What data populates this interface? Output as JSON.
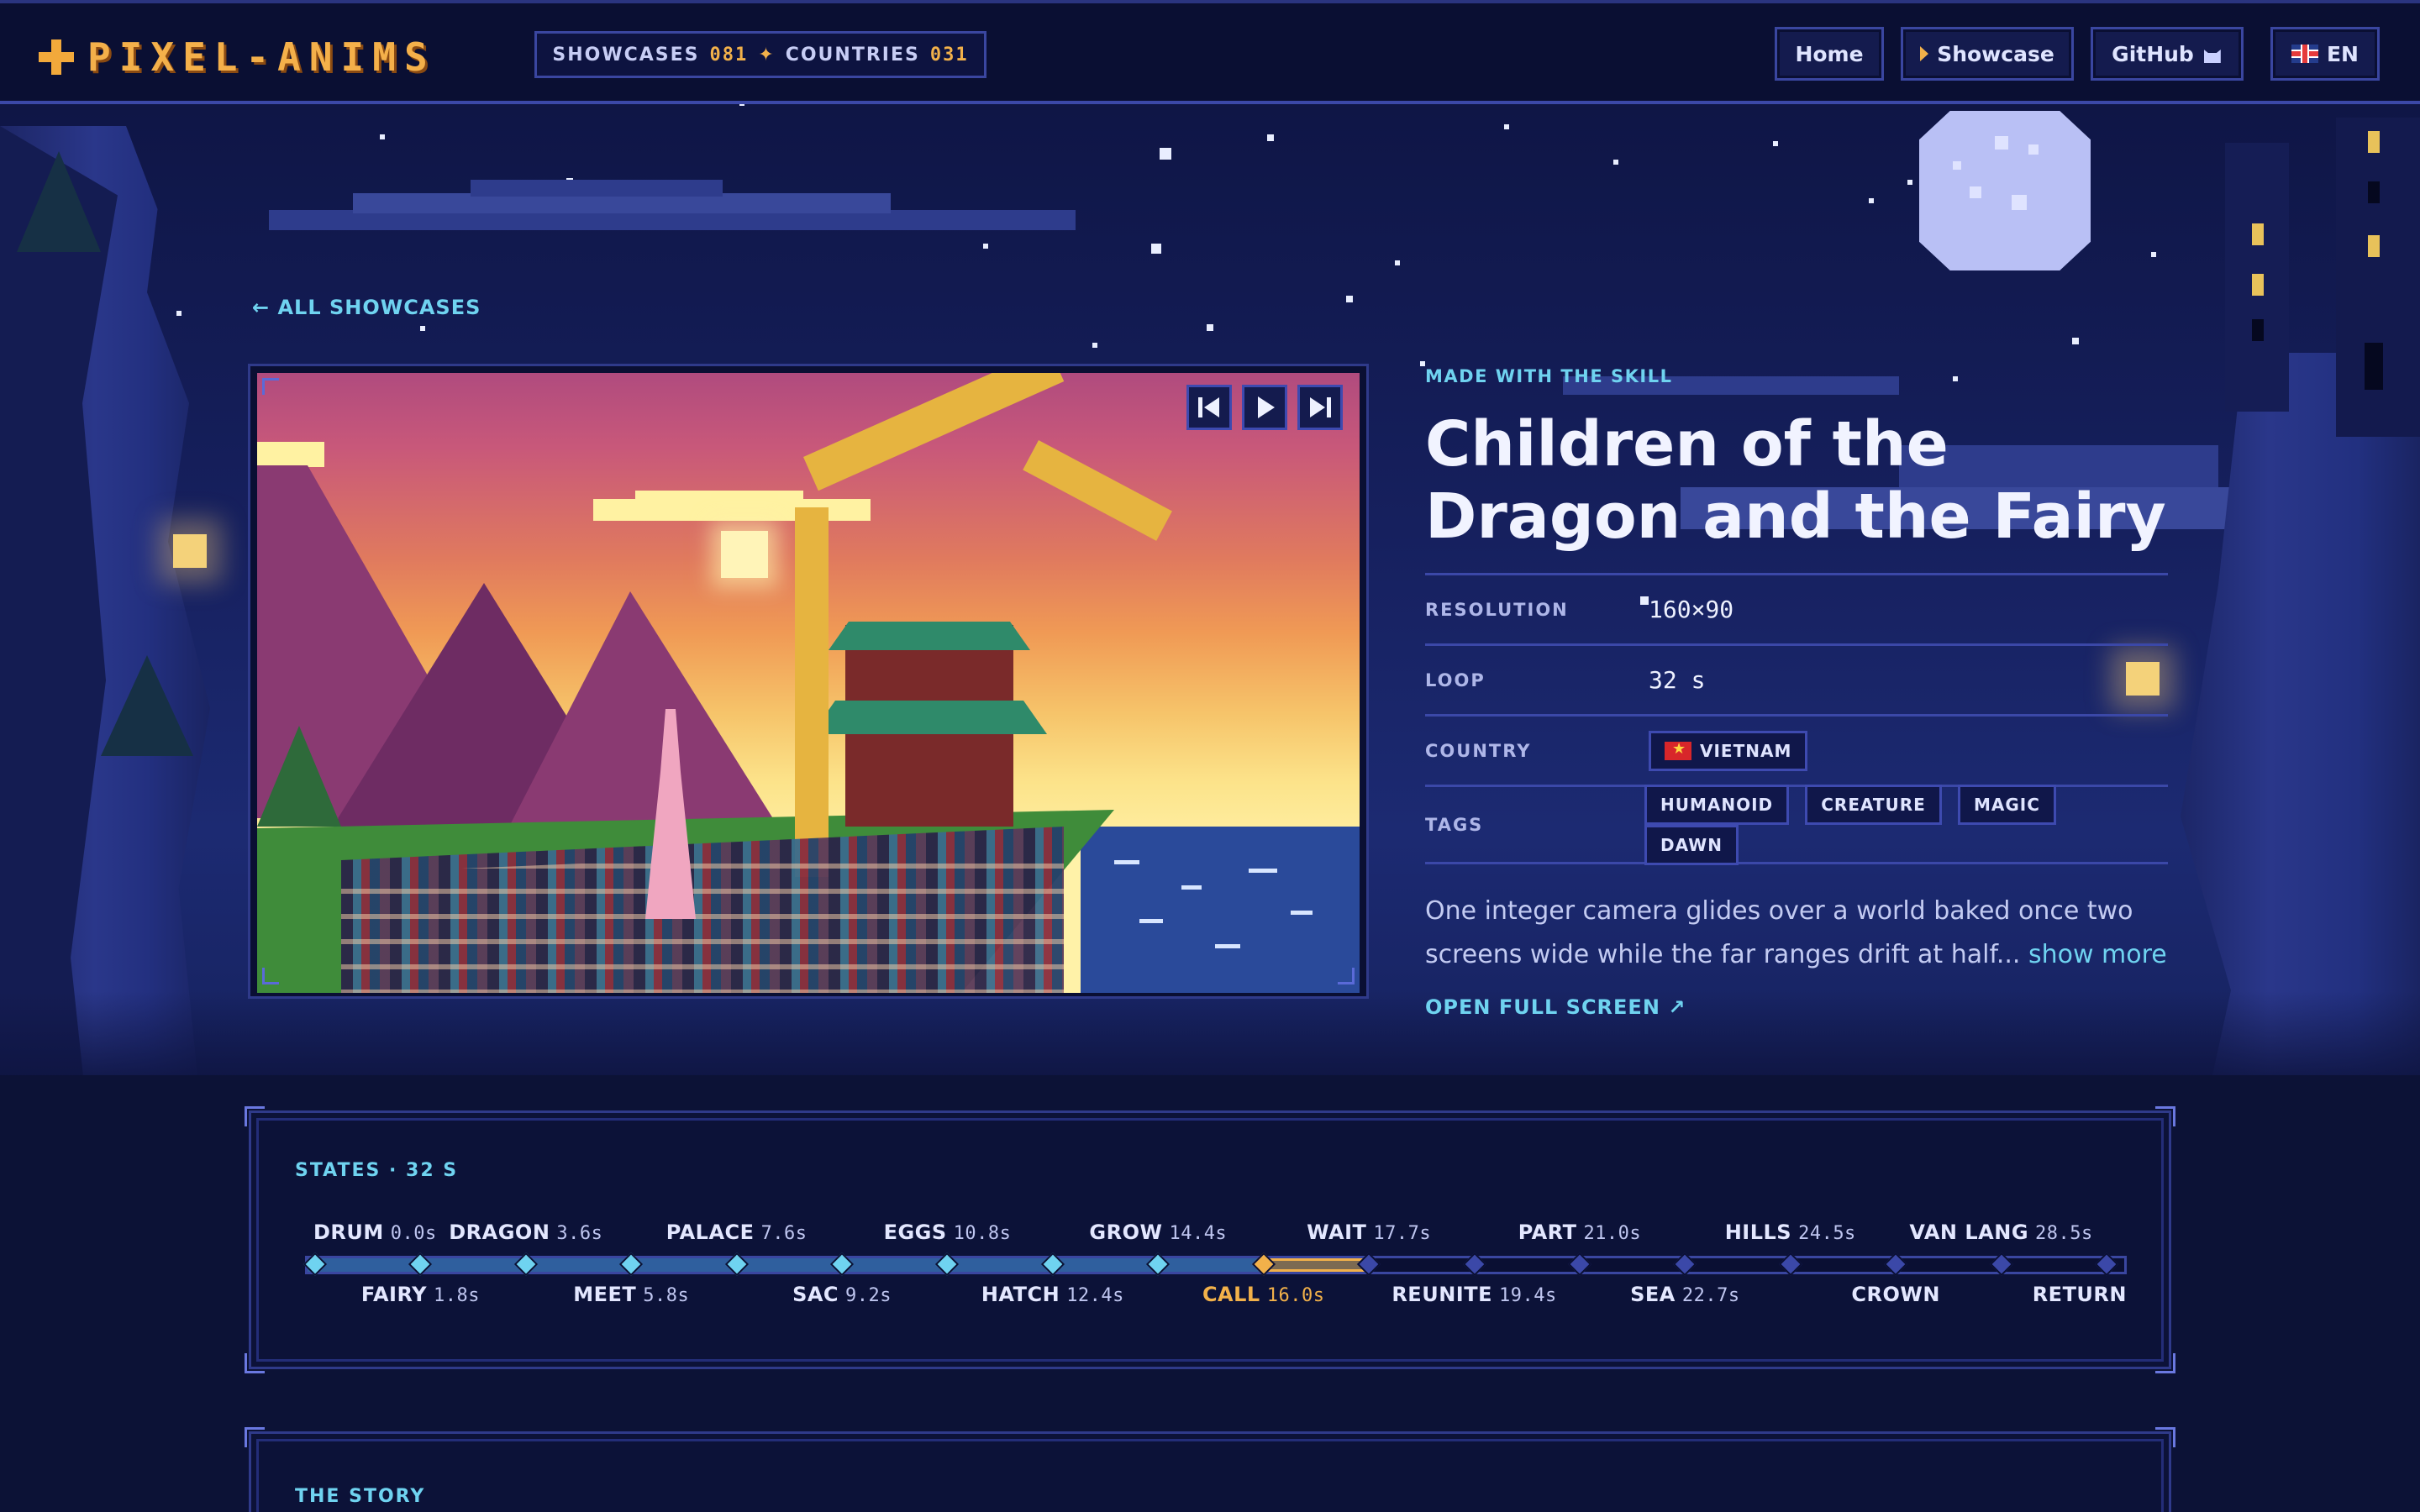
{
  "header": {
    "logo_text": "PIXEL-ANIMS",
    "showcases_label": "SHOWCASES",
    "showcases_count": "081",
    "countries_label": "COUNTRIES",
    "countries_count": "031",
    "nav": {
      "home": "Home",
      "showcase": "Showcase",
      "github": "GitHub",
      "language": "EN"
    }
  },
  "back_link": "← ALL SHOWCASES",
  "info": {
    "made_with": "MADE WITH THE SKILL",
    "title": "Children of the Dragon and the Fairy",
    "meta": [
      {
        "key": "RESOLUTION",
        "value": "160×90"
      },
      {
        "key": "LOOP",
        "value": "32 s"
      },
      {
        "key": "COUNTRY",
        "value": "VIETNAM"
      },
      {
        "key": "TAGS",
        "value": ""
      }
    ],
    "tags": [
      "HUMANOID",
      "CREATURE",
      "MAGIC",
      "DAWN"
    ],
    "description": "One integer camera glides over a world baked once two screens wide while the far ranges drift at half... ",
    "show_more": "show more",
    "open_full_screen": "OPEN FULL SCREEN ↗"
  },
  "states": {
    "title": "STATES · 32 S",
    "total_seconds": 32,
    "current_index": 9,
    "items": [
      {
        "name": "DRUM",
        "time": "0.0s"
      },
      {
        "name": "FAIRY",
        "time": "1.8s"
      },
      {
        "name": "DRAGON",
        "time": "3.6s"
      },
      {
        "name": "MEET",
        "time": "5.8s"
      },
      {
        "name": "PALACE",
        "time": "7.6s"
      },
      {
        "name": "SAC",
        "time": "9.2s"
      },
      {
        "name": "EGGS",
        "time": "10.8s"
      },
      {
        "name": "HATCH",
        "time": "12.4s"
      },
      {
        "name": "GROW",
        "time": "14.4s"
      },
      {
        "name": "CALL",
        "time": "16.0s"
      },
      {
        "name": "WAIT",
        "time": "17.7s"
      },
      {
        "name": "REUNITE",
        "time": "19.4s"
      },
      {
        "name": "PART",
        "time": "21.0s"
      },
      {
        "name": "SEA",
        "time": "22.7s"
      },
      {
        "name": "HILLS",
        "time": "24.5s"
      },
      {
        "name": "CROWN",
        "time": ""
      },
      {
        "name": "VAN LANG",
        "time": "28.5s"
      },
      {
        "name": "RETURN",
        "time": ""
      }
    ]
  },
  "story": {
    "title": "THE STORY"
  },
  "colors": {
    "accent_cyan": "#6fd3f0",
    "accent_gold": "#f2b14a",
    "panel_border": "#3b48a8",
    "background": "#0f1640"
  },
  "icons": {
    "skip_back": "skip-back-icon",
    "play": "play-icon",
    "skip_forward": "skip-forward-icon"
  }
}
